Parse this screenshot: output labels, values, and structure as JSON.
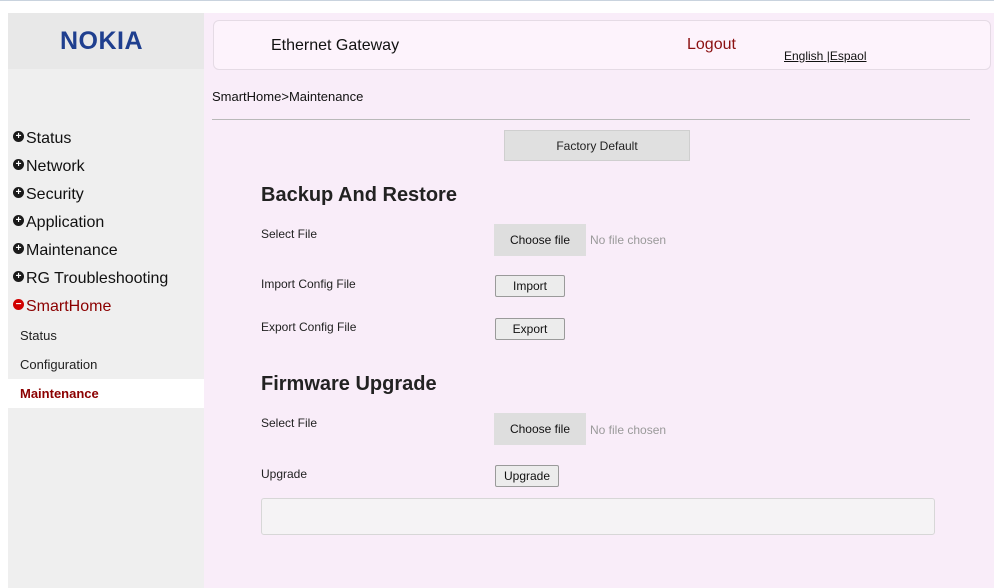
{
  "brand": {
    "logo_text": "NOKIA",
    "logo_color": "#1f3f8f"
  },
  "header": {
    "title": "Ethernet Gateway",
    "logout_label": "Logout",
    "lang_english": "English",
    "lang_separator": " |",
    "lang_spanish": "Espaol"
  },
  "sidebar": {
    "items": [
      {
        "label": "Status",
        "icon": "plus-icon"
      },
      {
        "label": "Network",
        "icon": "plus-icon"
      },
      {
        "label": "Security",
        "icon": "plus-icon"
      },
      {
        "label": "Application",
        "icon": "plus-icon"
      },
      {
        "label": "Maintenance",
        "icon": "plus-icon"
      },
      {
        "label": "RG Troubleshooting",
        "icon": "plus-icon"
      },
      {
        "label": "SmartHome",
        "icon": "minus-icon",
        "expanded": true
      }
    ],
    "subitems": [
      {
        "label": "Status"
      },
      {
        "label": "Configuration"
      },
      {
        "label": "Maintenance",
        "active": true
      }
    ]
  },
  "breadcrumb": "SmartHome>Maintenance",
  "factory_default_label": "Factory Default",
  "backup": {
    "title": "Backup And Restore",
    "select_file_label": "Select File",
    "choose_file_label": "Choose file",
    "no_file_text": "No file chosen",
    "import_label": "Import Config File",
    "import_button": "Import",
    "export_label": "Export Config File",
    "export_button": "Export"
  },
  "firmware": {
    "title": "Firmware Upgrade",
    "select_file_label": "Select File",
    "choose_file_label": "Choose file",
    "no_file_text": "No file chosen",
    "upgrade_label": "Upgrade",
    "upgrade_button": "Upgrade"
  },
  "colors": {
    "accent_red": "#8b0000",
    "main_bg": "#f9edf9",
    "sidebar_bg": "#efefef"
  }
}
